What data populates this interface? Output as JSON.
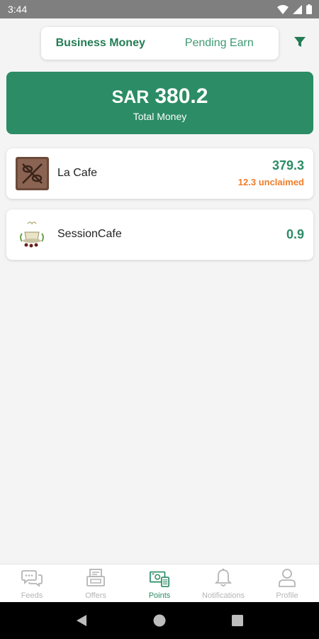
{
  "status_bar": {
    "time": "3:44"
  },
  "header": {
    "tabs": [
      {
        "label": "Business Money",
        "active": true
      },
      {
        "label": "Pending Earn",
        "active": false
      }
    ],
    "filter_icon": "filter-icon"
  },
  "total": {
    "currency": "SAR",
    "amount": "380.2",
    "label": "Total Money"
  },
  "businesses": [
    {
      "name": "La Cafe",
      "amount": "379.3",
      "unclaimed": "12.3 unclaimed",
      "logo_icon": "la-cafe-logo"
    },
    {
      "name": "SessionCafe",
      "amount": "0.9",
      "logo_icon": "session-cafe-logo"
    }
  ],
  "bottom_nav": {
    "items": [
      {
        "label": "Feeds",
        "icon": "feeds-icon",
        "active": false
      },
      {
        "label": "Offers",
        "icon": "offers-icon",
        "active": false
      },
      {
        "label": "Points",
        "icon": "points-icon",
        "active": true
      },
      {
        "label": "Notifications",
        "icon": "bell-icon",
        "active": false
      },
      {
        "label": "Profile",
        "icon": "profile-icon",
        "active": false
      }
    ]
  },
  "colors": {
    "brand_green": "#2b8c65",
    "accent_orange": "#ef7d2c",
    "inactive_gray": "#b5b5b5"
  }
}
